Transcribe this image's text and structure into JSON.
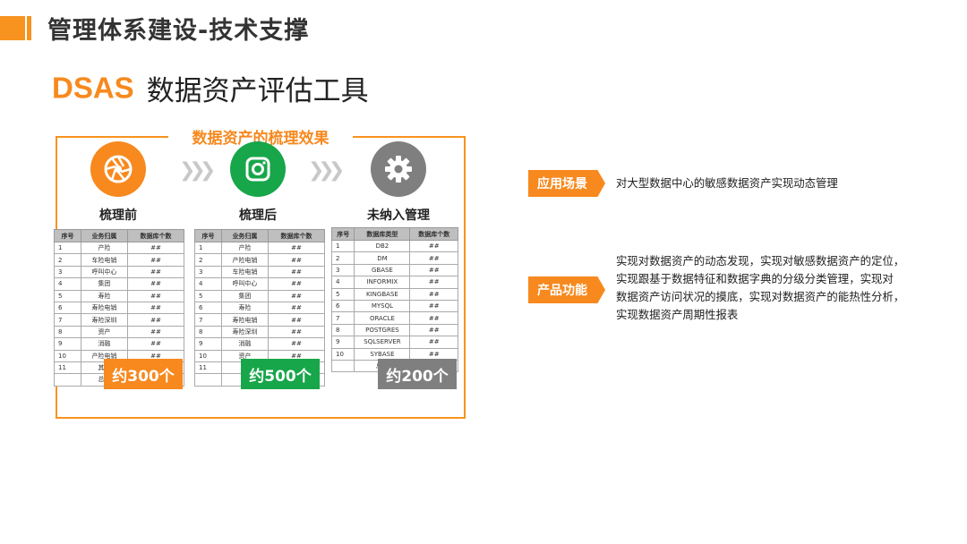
{
  "header": {
    "title": "管理体系建设-技术支撑",
    "brand": "DSAS",
    "subtitle": "数据资产评估工具"
  },
  "frame": {
    "title": "数据资产的梳理效果"
  },
  "stages": [
    {
      "label": "梳理前",
      "icon": "aperture-icon",
      "color": "#f7891e"
    },
    {
      "label": "梳理后",
      "icon": "camera-icon",
      "color": "#17a64a"
    },
    {
      "label": "未纳入管理",
      "icon": "gear-icon",
      "color": "#7f7f7f"
    }
  ],
  "table_before": {
    "headers": [
      "序号",
      "业务归属",
      "数据库个数"
    ],
    "rows": [
      [
        "1",
        "产险",
        "##"
      ],
      [
        "2",
        "车险电销",
        "##"
      ],
      [
        "3",
        "呼叫中心",
        "##"
      ],
      [
        "4",
        "集团",
        "##"
      ],
      [
        "5",
        "寿险",
        "##"
      ],
      [
        "6",
        "寿险电销",
        "##"
      ],
      [
        "7",
        "寿险深圳",
        "##"
      ],
      [
        "8",
        "资产",
        "##"
      ],
      [
        "9",
        "消融",
        "##"
      ],
      [
        "10",
        "产险电销",
        "##"
      ],
      [
        "11",
        "其他",
        "##"
      ],
      [
        "",
        "总计",
        ""
      ]
    ],
    "count": "约300个"
  },
  "table_after": {
    "headers": [
      "序号",
      "业务归属",
      "数据库个数"
    ],
    "rows": [
      [
        "1",
        "产险",
        "##"
      ],
      [
        "2",
        "产险电销",
        "##"
      ],
      [
        "3",
        "车险电销",
        "##"
      ],
      [
        "4",
        "呼叫中心",
        "##"
      ],
      [
        "5",
        "集团",
        "##"
      ],
      [
        "6",
        "寿险",
        "##"
      ],
      [
        "7",
        "寿险电销",
        "##"
      ],
      [
        "8",
        "寿险深圳",
        "##"
      ],
      [
        "9",
        "消融",
        "##"
      ],
      [
        "10",
        "资产",
        "##"
      ],
      [
        "11",
        "",
        "##"
      ],
      [
        "",
        "",
        ""
      ]
    ],
    "count": "约500个"
  },
  "table_unmanaged": {
    "headers": [
      "序号",
      "数据库类型",
      "数据库个数"
    ],
    "rows": [
      [
        "1",
        "DB2",
        "##"
      ],
      [
        "2",
        "DM",
        "##"
      ],
      [
        "3",
        "GBASE",
        "##"
      ],
      [
        "4",
        "INFORMIX",
        "##"
      ],
      [
        "5",
        "KINGBASE",
        "##"
      ],
      [
        "6",
        "MYSQL",
        "##"
      ],
      [
        "7",
        "ORACLE",
        "##"
      ],
      [
        "8",
        "POSTGRES",
        "##"
      ],
      [
        "9",
        "SQLSERVER",
        "##"
      ],
      [
        "10",
        "SYBASE",
        "##"
      ],
      [
        "",
        "总计",
        ""
      ]
    ],
    "count": "约200个"
  },
  "scenario": {
    "tag": "应用场景",
    "text": "对大型数据中心的敏感数据资产实现动态管理"
  },
  "features": {
    "tag": "产品功能",
    "lines": [
      "实现对数据资产的动态发现，实现对敏感数据资产的定位，",
      "实现跟基于数据特征和数据字典的分级分类管理，实现对",
      "数据资产访问状况的摸底，实现对数据资产的能热性分析，",
      "实现数据资产周期性报表"
    ]
  },
  "colors": {
    "accent": "#f7891e",
    "green": "#17a64a",
    "gray": "#7f7f7f"
  }
}
